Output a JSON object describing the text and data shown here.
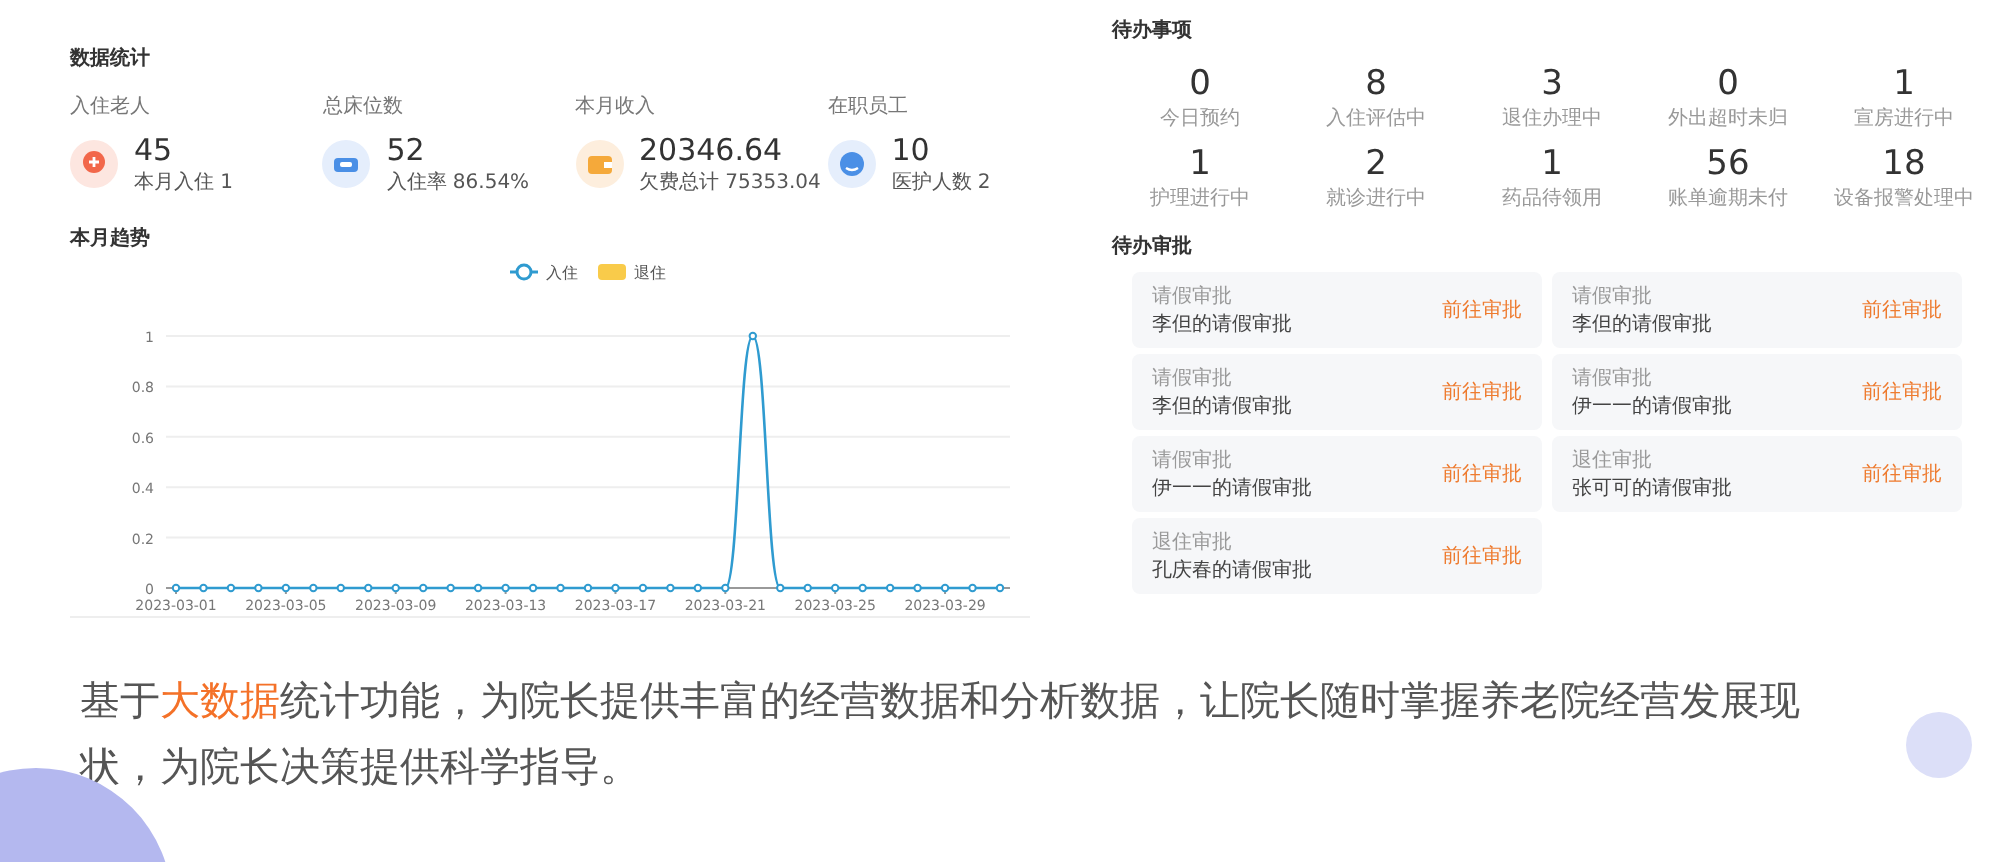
{
  "statistics": {
    "title": "数据统计",
    "items": [
      {
        "kind": "elder",
        "label": "入住老人",
        "value": "45",
        "sub": "本月入住 1"
      },
      {
        "kind": "bed",
        "label": "总床位数",
        "value": "52",
        "sub": "入住率 86.54%"
      },
      {
        "kind": "wallet",
        "label": "本月收入",
        "value": "20346.64",
        "sub": "欠费总计 75353.04"
      },
      {
        "kind": "staff",
        "label": "在职员工",
        "value": "10",
        "sub": "医护人数 2"
      }
    ]
  },
  "trend": {
    "title": "本月趋势",
    "chart_data": {
      "type": "line",
      "grid": true,
      "categories": [
        "2023-03-01",
        null,
        null,
        null,
        "2023-03-05",
        null,
        null,
        null,
        "2023-03-09",
        null,
        null,
        null,
        "2023-03-13",
        null,
        null,
        null,
        "2023-03-17",
        null,
        null,
        null,
        "2023-03-21",
        null,
        null,
        null,
        "2023-03-25",
        null,
        null,
        null,
        "2023-03-29",
        null,
        null
      ],
      "ylim": [
        0,
        1
      ],
      "yticks": [
        0,
        0.2,
        0.4,
        0.6,
        0.8,
        1
      ],
      "series": [
        {
          "name": "入住",
          "color": "#2f9bd0",
          "marker": "circle",
          "values": [
            0,
            0,
            0,
            0,
            0,
            0,
            0,
            0,
            0,
            0,
            0,
            0,
            0,
            0,
            0,
            0,
            0,
            0,
            0,
            0,
            0,
            1,
            0,
            0,
            0,
            0,
            0,
            0,
            0,
            0,
            0
          ]
        },
        {
          "name": "退住",
          "color": "#f9cb4a",
          "values": [
            null,
            null,
            null,
            null,
            null,
            null,
            null,
            null,
            null,
            null,
            null,
            null,
            null,
            null,
            null,
            null,
            null,
            null,
            null,
            null,
            null,
            null,
            null,
            null,
            null,
            null,
            null,
            null,
            null,
            null,
            null
          ]
        }
      ]
    }
  },
  "todo": {
    "title": "待办事项",
    "items": [
      {
        "value": "0",
        "label": "今日预约"
      },
      {
        "value": "8",
        "label": "入住评估中"
      },
      {
        "value": "3",
        "label": "退住办理中"
      },
      {
        "value": "0",
        "label": "外出超时未归"
      },
      {
        "value": "1",
        "label": "宣房进行中"
      },
      {
        "value": "1",
        "label": "护理进行中"
      },
      {
        "value": "2",
        "label": "就诊进行中"
      },
      {
        "value": "1",
        "label": "药品待领用"
      },
      {
        "value": "56",
        "label": "账单逾期未付"
      },
      {
        "value": "18",
        "label": "设备报警处理中"
      }
    ]
  },
  "approvals": {
    "title": "待办审批",
    "items": [
      {
        "type": "请假审批",
        "title": "李但的请假审批",
        "action": "前往审批"
      },
      {
        "type": "请假审批",
        "title": "李但的请假审批",
        "action": "前往审批"
      },
      {
        "type": "请假审批",
        "title": "李但的请假审批",
        "action": "前往审批"
      },
      {
        "type": "请假审批",
        "title": "伊一一的请假审批",
        "action": "前往审批"
      },
      {
        "type": "请假审批",
        "title": "伊一一的请假审批",
        "action": "前往审批"
      },
      {
        "type": "退住审批",
        "title": "张可可的请假审批",
        "action": "前往审批"
      },
      {
        "type": "退住审批",
        "title": "孔庆春的请假审批",
        "action": "前往审批"
      }
    ]
  },
  "caption": [
    {
      "text": "基于",
      "highlight": false
    },
    {
      "text": "大数据",
      "highlight": true
    },
    {
      "text": "统计功能，为院长提供丰富的经营数据和分析数据，让院长随时掌握养老院经营发展现状，为院长决策提供科学指导。",
      "highlight": false
    }
  ]
}
